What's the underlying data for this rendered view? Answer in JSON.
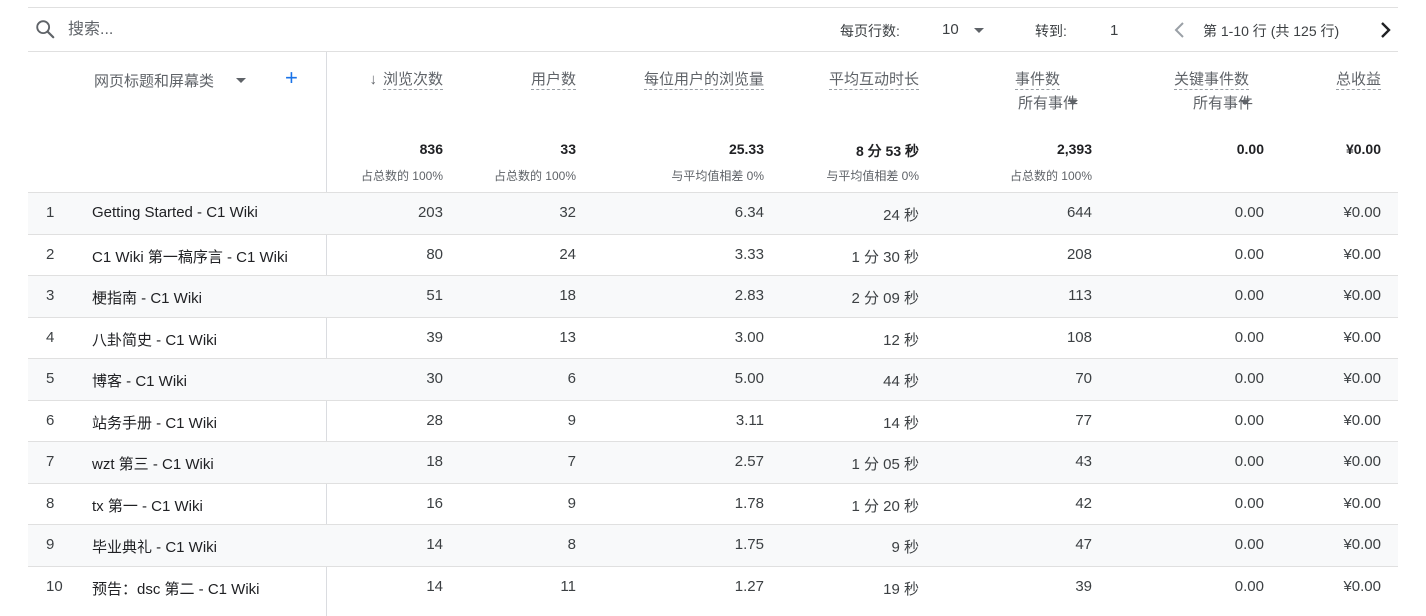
{
  "toolbar": {
    "search_placeholder": "搜索...",
    "rows_per_page_label": "每页行数:",
    "rows_per_page_value": "10",
    "goto_label": "转到:",
    "goto_value": "1",
    "page_info": "第 1-10 行 (共 125 行)"
  },
  "headers": {
    "dimension": "网页标题和屏幕类",
    "views": "浏览次数",
    "users": "用户数",
    "views_per_user": "每位用户的浏览量",
    "avg_engagement": "平均互动时长",
    "event_count": "事件数",
    "event_count_sub": "所有事件",
    "key_events": "关键事件数",
    "key_events_sub": "所有事件",
    "revenue": "总收益"
  },
  "totals": {
    "views": "836",
    "views_sub": "占总数的 100%",
    "users": "33",
    "users_sub": "占总数的 100%",
    "views_per_user": "25.33",
    "views_per_user_sub": "与平均值相差 0%",
    "avg_engagement": "8 分 53 秒",
    "avg_engagement_sub": "与平均值相差 0%",
    "event_count": "2,393",
    "event_count_sub": "占总数的 100%",
    "key_events": "0.00",
    "revenue": "¥0.00"
  },
  "rows": [
    {
      "idx": "1",
      "title": "Getting Started - C1 Wiki",
      "views": "203",
      "users": "32",
      "vpu": "6.34",
      "eng": "24 秒",
      "events": "644",
      "key": "0.00",
      "rev": "¥0.00"
    },
    {
      "idx": "2",
      "title": "C1 Wiki 第一稿序言 - C1 Wiki",
      "views": "80",
      "users": "24",
      "vpu": "3.33",
      "eng": "1 分 30 秒",
      "events": "208",
      "key": "0.00",
      "rev": "¥0.00"
    },
    {
      "idx": "3",
      "title": "梗指南 - C1 Wiki",
      "views": "51",
      "users": "18",
      "vpu": "2.83",
      "eng": "2 分 09 秒",
      "events": "113",
      "key": "0.00",
      "rev": "¥0.00"
    },
    {
      "idx": "4",
      "title": "八卦简史 - C1 Wiki",
      "views": "39",
      "users": "13",
      "vpu": "3.00",
      "eng": "12 秒",
      "events": "108",
      "key": "0.00",
      "rev": "¥0.00"
    },
    {
      "idx": "5",
      "title": "博客 - C1 Wiki",
      "views": "30",
      "users": "6",
      "vpu": "5.00",
      "eng": "44 秒",
      "events": "70",
      "key": "0.00",
      "rev": "¥0.00"
    },
    {
      "idx": "6",
      "title": "站务手册 - C1 Wiki",
      "views": "28",
      "users": "9",
      "vpu": "3.11",
      "eng": "14 秒",
      "events": "77",
      "key": "0.00",
      "rev": "¥0.00"
    },
    {
      "idx": "7",
      "title": "wzt 第三 - C1 Wiki",
      "views": "18",
      "users": "7",
      "vpu": "2.57",
      "eng": "1 分 05 秒",
      "events": "43",
      "key": "0.00",
      "rev": "¥0.00"
    },
    {
      "idx": "8",
      "title": "tx 第一 - C1 Wiki",
      "views": "16",
      "users": "9",
      "vpu": "1.78",
      "eng": "1 分 20 秒",
      "events": "42",
      "key": "0.00",
      "rev": "¥0.00"
    },
    {
      "idx": "9",
      "title": "毕业典礼 - C1 Wiki",
      "views": "14",
      "users": "8",
      "vpu": "1.75",
      "eng": "9 秒",
      "events": "47",
      "key": "0.00",
      "rev": "¥0.00"
    },
    {
      "idx": "10",
      "title": "预告：dsc 第二 - C1 Wiki",
      "views": "14",
      "users": "11",
      "vpu": "1.27",
      "eng": "19 秒",
      "events": "39",
      "key": "0.00",
      "rev": "¥0.00"
    }
  ]
}
